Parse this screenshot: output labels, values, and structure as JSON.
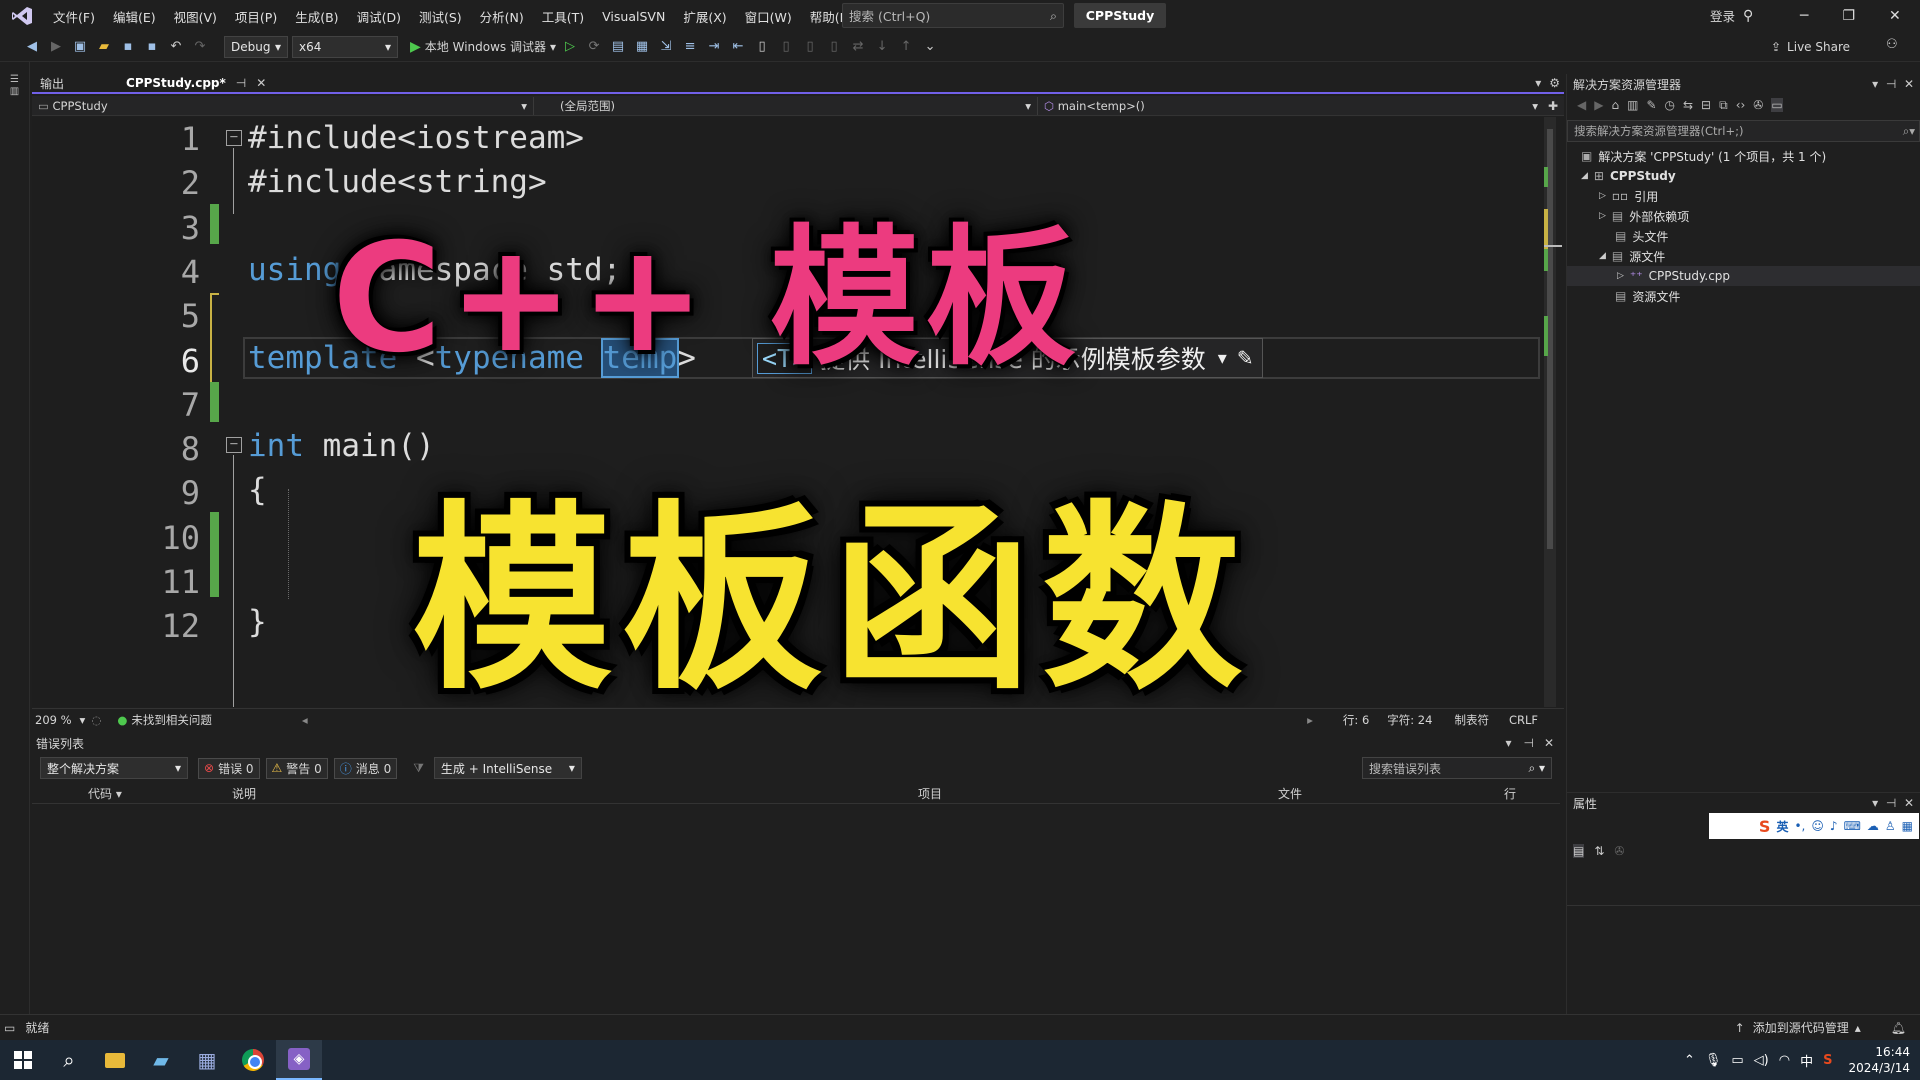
{
  "menu": {
    "items": [
      "文件(F)",
      "编辑(E)",
      "视图(V)",
      "项目(P)",
      "生成(B)",
      "调试(D)",
      "测试(S)",
      "分析(N)",
      "工具(T)",
      "VisualSVN",
      "扩展(X)",
      "窗口(W)",
      "帮助(H)"
    ],
    "search_placeholder": "搜索 (Ctrl+Q)",
    "project_name": "CPPStudy",
    "login": "登录"
  },
  "toolbar": {
    "config": "Debug",
    "platform": "x64",
    "run_label": "本地 Windows 调试器",
    "live_share": "Live Share"
  },
  "tabs": {
    "output": "输出",
    "file": "CPPStudy.cpp*"
  },
  "navbar": {
    "project": "CPPStudy",
    "scope": "(全局范围)",
    "member": "main<temp>()"
  },
  "code": {
    "line_numbers": [
      "1",
      "2",
      "3",
      "4",
      "5",
      "6",
      "7",
      "8",
      "9",
      "10",
      "11",
      "12"
    ],
    "l1": "#include<iostream>",
    "l2": "#include<string>",
    "l4a": "using",
    "l4b": " namespace std;",
    "l6a": "template",
    "l6b": " <",
    "l6c": "typename",
    "l6d": " ",
    "l6e": "temp",
    "l6f": ">",
    "l8a": "int",
    "l8b": " main()",
    "l9": "{",
    "l12": "}",
    "hint_tag": "<T>",
    "hint_text": "提供 IntelliSense 的示例模板参数"
  },
  "overlay": {
    "title": "C++ 模板",
    "subtitle": "模板函数"
  },
  "editor_status": {
    "zoom": "209 %",
    "issues": "未找到相关问题",
    "line": "行: 6",
    "char": "字符: 24",
    "tabs": "制表符",
    "eol": "CRLF"
  },
  "error_list": {
    "title": "错误列表",
    "scope": "整个解决方案",
    "errors": "错误 0",
    "warnings": "警告 0",
    "messages": "消息 0",
    "build_filter": "生成 + IntelliSense",
    "search_placeholder": "搜索错误列表",
    "columns": [
      "代码",
      "说明",
      "项目",
      "文件",
      "行"
    ]
  },
  "solution_explorer": {
    "title": "解决方案资源管理器",
    "search_placeholder": "搜索解决方案资源管理器(Ctrl+;)",
    "solution": "解决方案 'CPPStudy' (1 个项目，共 1 个)",
    "project": "CPPStudy",
    "items": [
      "引用",
      "外部依赖项",
      "头文件",
      "源文件",
      "CPPStudy.cpp",
      "资源文件"
    ]
  },
  "properties": {
    "title": "属性",
    "ime_label": "英"
  },
  "status": {
    "ready": "就绪",
    "source_control": "添加到源代码管理"
  },
  "taskbar": {
    "time": "16:44",
    "date": "2024/3/14"
  }
}
